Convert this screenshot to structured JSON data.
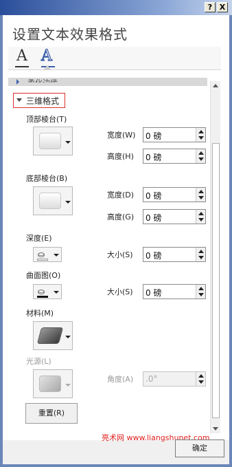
{
  "window": {
    "help_label": "?",
    "close_label": "X"
  },
  "pane": {
    "title": "设置文本效果格式",
    "tabs": [
      {
        "label": "A",
        "icon": "text-fill-outline-icon"
      },
      {
        "label": "A",
        "icon": "text-effects-icon"
      }
    ],
    "collapsed_section_cut": "柔化边缘"
  },
  "section": {
    "title": "三维格式",
    "top_bevel": {
      "label": "顶部棱台(T)",
      "width_label": "宽度(W)",
      "width_value": "0 磅",
      "height_label": "高度(H)",
      "height_value": "0 磅"
    },
    "bottom_bevel": {
      "label": "底部棱台(B)",
      "width_label": "宽度(D)",
      "width_value": "0 磅",
      "height_label": "高度(G)",
      "height_value": "0 磅"
    },
    "depth": {
      "label": "深度(E)",
      "size_label": "大小(S)",
      "size_value": "0 磅"
    },
    "contour": {
      "label": "曲面图(O)",
      "size_label": "大小(S)",
      "size_value": "0 磅"
    },
    "material": {
      "label": "材料(M)"
    },
    "lighting": {
      "label": "光源(L)",
      "angle_label": "角度(A)",
      "angle_value": ".0°"
    },
    "reset_label": "重置(R)"
  },
  "watermark": "亮术网 www.liangshunet.com",
  "footer": {
    "ok_label": "确定"
  },
  "colors": {
    "highlight_box": "#d9302c",
    "watermark": "#e02020",
    "titlebar": "#2a4e9a"
  }
}
